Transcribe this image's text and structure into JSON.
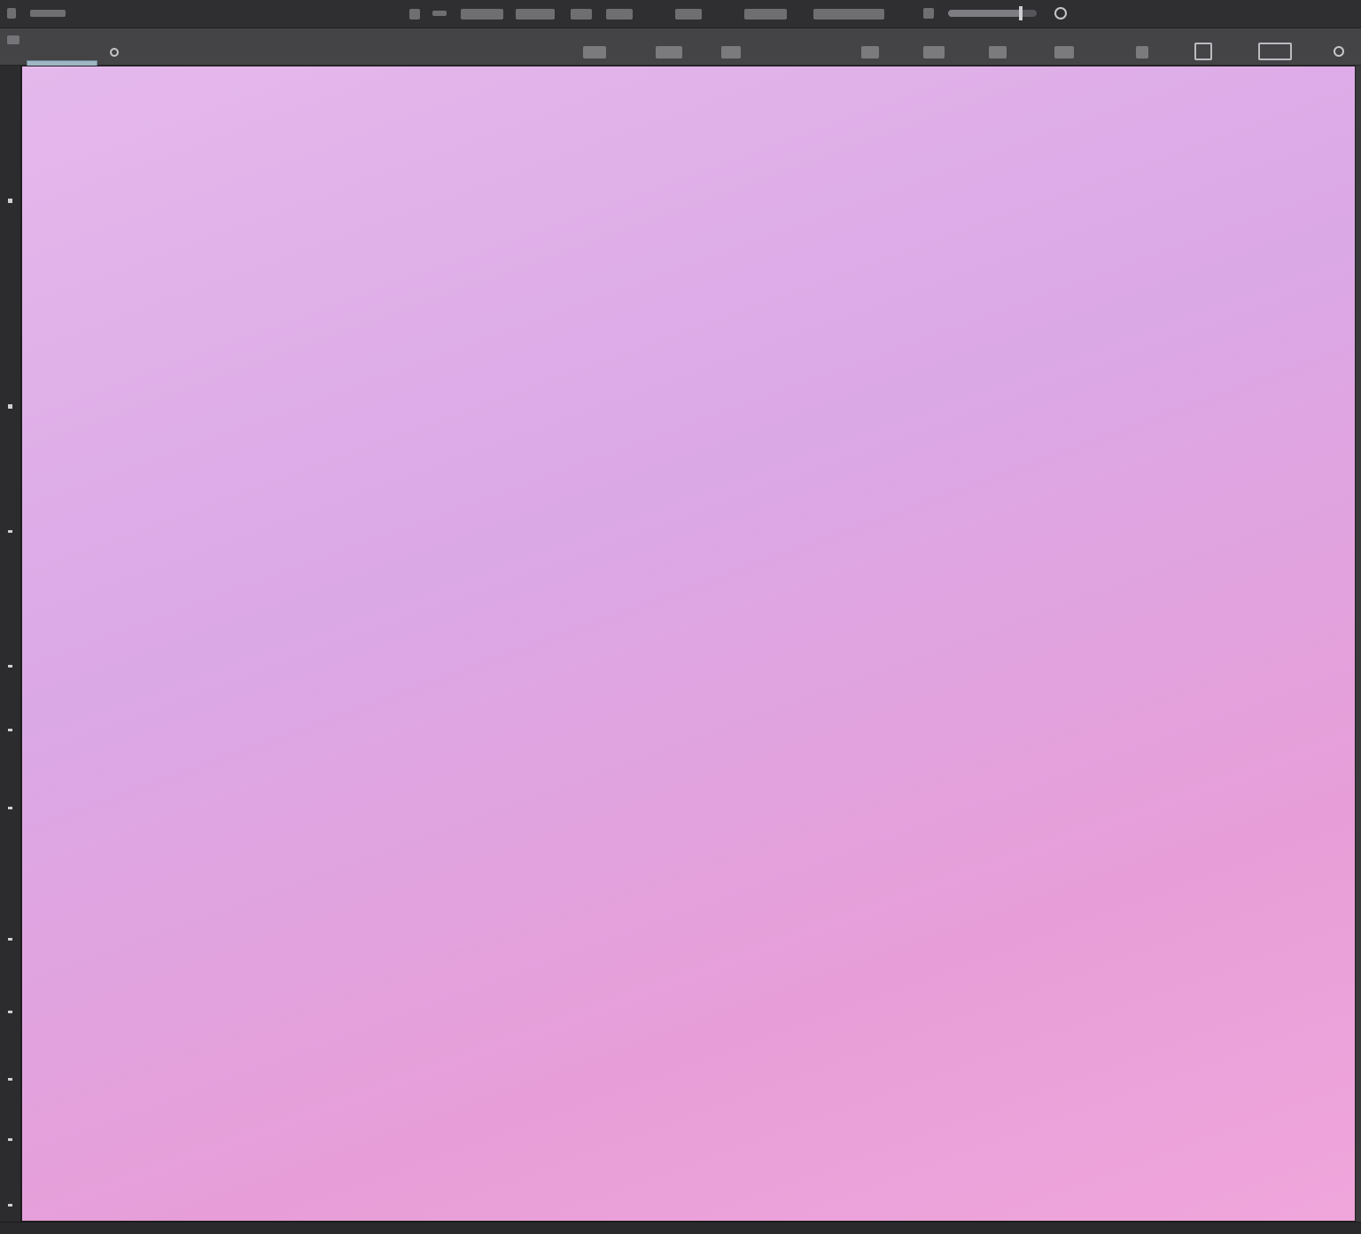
{
  "window": {
    "title": ""
  },
  "menu": {
    "items": [
      {
        "label": ""
      },
      {
        "label": ""
      },
      {
        "label": ""
      },
      {
        "label": ""
      },
      {
        "label": ""
      },
      {
        "label": ""
      },
      {
        "label": ""
      },
      {
        "label": ""
      },
      {
        "label": ""
      },
      {
        "label": ""
      },
      {
        "label": ""
      }
    ]
  },
  "toolbar": {
    "name_field_value": "",
    "path_value": "",
    "zoom_slider_value": 0.82,
    "icons": [
      "brush-icon",
      "opacity-slider-icon",
      "drop-icon",
      "cycle-icon",
      "layer-toggle-icon",
      "frame-icon",
      "close-circle-icon"
    ]
  },
  "canvas": {
    "background_colors": [
      "#e5b8ec",
      "#dba8e6",
      "#e79ed8",
      "#f0a6db"
    ],
    "image_note": ""
  },
  "status": {
    "text": ""
  }
}
